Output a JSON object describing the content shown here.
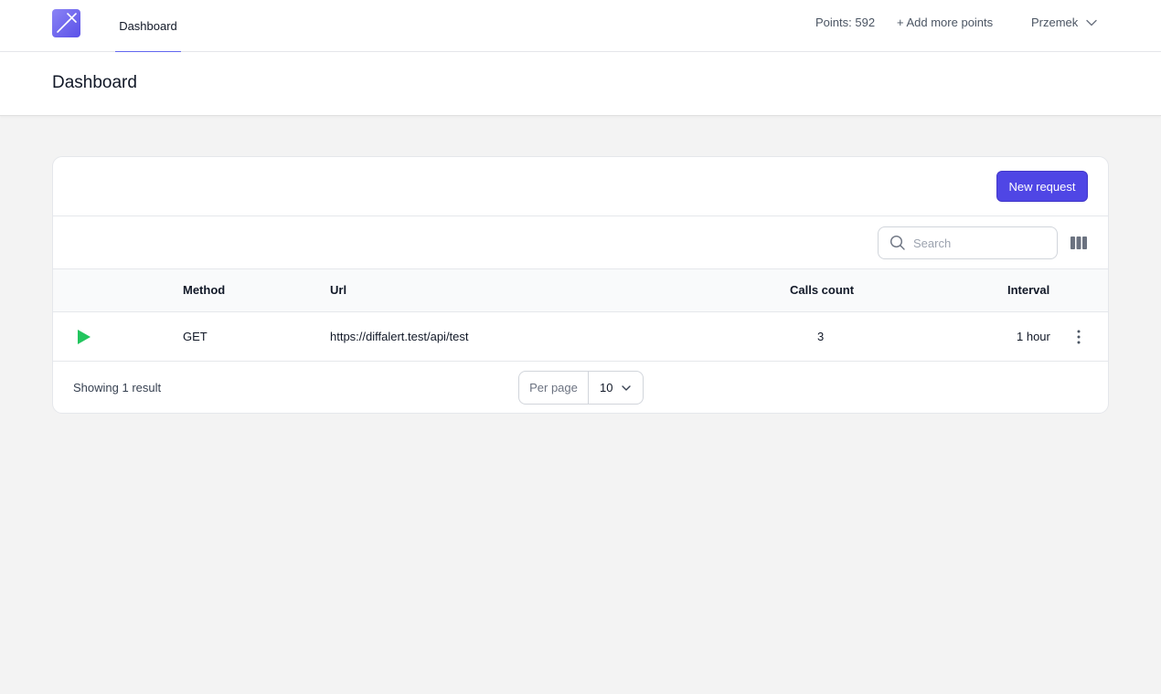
{
  "nav": {
    "tab": "Dashboard",
    "points": "Points: 592",
    "add_points": "+ Add more points",
    "user": "Przemek"
  },
  "header": {
    "title": "Dashboard"
  },
  "card": {
    "new_button": "New request",
    "search": {
      "placeholder": "Search",
      "value": ""
    },
    "columns": {
      "method": "Method",
      "url": "Url",
      "calls": "Calls count",
      "interval": "Interval"
    },
    "rows": [
      {
        "method": "GET",
        "url": "https://diffalert.test/api/test",
        "calls": "3",
        "interval": "1 hour"
      }
    ],
    "footer": {
      "showing": "Showing 1 result",
      "per_page_label": "Per page",
      "per_page_value": "10"
    }
  },
  "colors": {
    "accent": "#4f46e5",
    "play": "#22c55e",
    "tab_underline": "#6366f1"
  }
}
